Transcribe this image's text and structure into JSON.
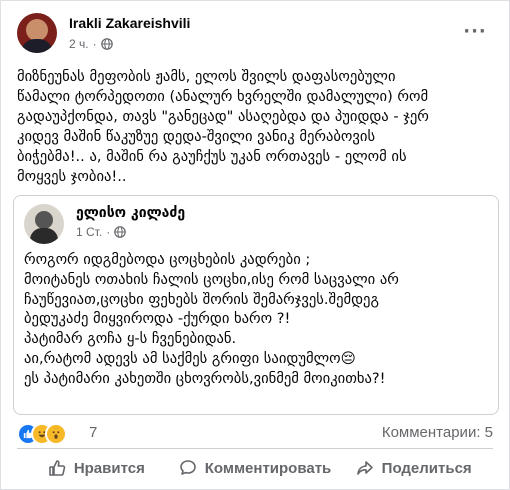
{
  "post": {
    "author": "Irakli Zakareishvili",
    "time": "2 ч.",
    "lines": [
      "მიზნეუნას მეფობის ჟამს, ელოს შვილს დაფასოებული",
      "წამალი ტორპედოთი (ანალურ ხვრელში დამალული) რომ",
      "გადაუპქონდა, თავს \"განეცად\" ასაღებდა და პუიდდა - ჯერ",
      "კიდევ მაშინ წაკუზუე დედა-შვილი ვანიკ მერაბოვის",
      "ბიჭებმა!.. ა, მაშინ რა გაუჩქუს უკან ორთავეს - ელომ ის",
      "მოყვეს ჯობია!.."
    ]
  },
  "shared": {
    "author": "ელისო კილაძე",
    "time": "1 Ст.",
    "lines": [
      "როგორ იდგმებოდა ცოცხების კადრები ;",
      "მოიტანეს ოთახის ჩალის ცოცხი,ისე რომ საცვალი არ",
      "ჩაუწევიათ,ცოცხი ფეხებს შორის შემარჯვეს.შემდეგ",
      "ბედუკაძე მიყვიროდა -ქურდი ხარო ?!",
      "პატიმარ გოჩა ყ-ს ჩვენებიდან.",
      "აი,რატომ ადევს ამ საქმეს გრიფი საიდუმლო😔",
      "ეს პატიმარი კახეთში ცხოვრობს,ვინმემ მოიკითხა?!"
    ]
  },
  "reactions": {
    "count": "7",
    "comments": "Комментарии: 5",
    "icons": [
      "like-icon",
      "haha-icon",
      "wow-icon"
    ]
  },
  "actions": {
    "like": "Нравится",
    "comment": "Комментировать",
    "share": "Поделиться"
  },
  "colors": {
    "accent": "#1877f2",
    "secondary_text": "#65676b",
    "divider": "#ced0d4"
  }
}
